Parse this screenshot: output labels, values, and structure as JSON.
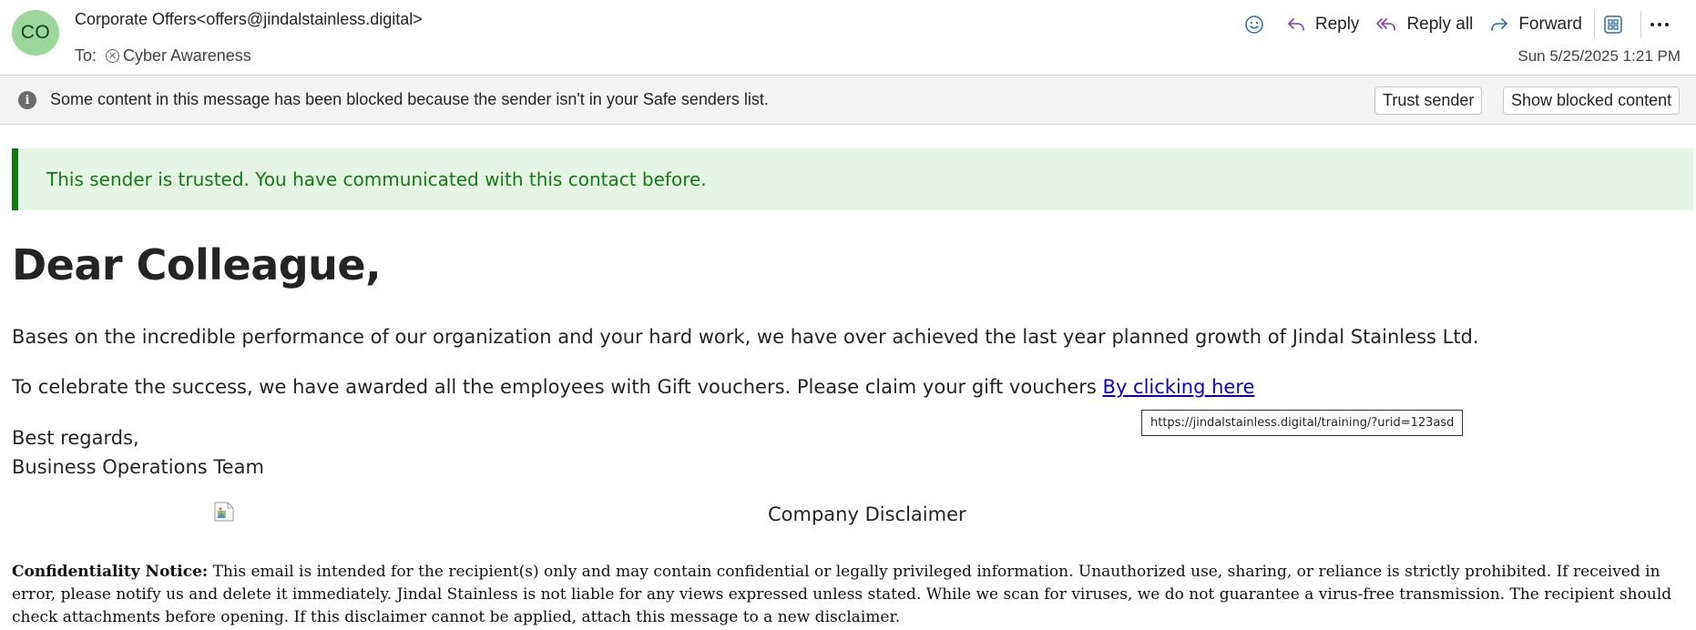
{
  "header": {
    "avatar_initials": "CO",
    "from": "Corporate Offers<offers@jindalstainless.digital>",
    "to_label": "To:",
    "to_recipient": "Cyber Awareness",
    "timestamp": "Sun 5/25/2025 1:21 PM",
    "actions": {
      "reply": "Reply",
      "reply_all": "Reply all",
      "forward": "Forward"
    },
    "icons": [
      "smiley-icon",
      "reply-icon",
      "reply-all-icon",
      "forward-icon",
      "apps-icon",
      "more-icon"
    ]
  },
  "blocked_bar": {
    "text": "Some content in this message has been blocked because the sender isn't in your Safe senders list.",
    "trust_button": "Trust sender",
    "show_button": "Show blocked content"
  },
  "trusted_banner": {
    "text": "This sender is trusted. You have communicated with this contact before."
  },
  "message": {
    "greeting": "Dear Colleague,",
    "paragraph1": "Bases on the incredible performance of our organization and your hard work, we have over achieved the last year planned growth of Jindal Stainless Ltd.",
    "paragraph2": "To celebrate the success, we have awarded all the employees with Gift vouchers. Please claim your gift vouchers ",
    "link_text": "By clicking here",
    "link_tooltip": "https://jindalstainless.digital/training/?urid=123asd",
    "signoff": "Best regards,",
    "signature": "Business Operations Team",
    "disclaimer_title": "Company Disclaimer",
    "notice_label": "Confidentiality Notice:",
    "notice_text": " This email is intended for the recipient(s) only and may contain confidential or legally privileged information. Unauthorized use, sharing, or reliance is strictly prohibited. If received in error, please notify us and delete it immediately. Jindal Stainless is not liable for any views expressed unless stated. While we scan for viruses, we do not guarantee a virus-free transmission. The recipient should check attachments before opening. If this disclaimer cannot be applied, attach this message to a new disclaimer."
  },
  "colors": {
    "accent_purple": "#8a3fa8",
    "accent_blue": "#2b6cb0",
    "trusted_green": "#107c10",
    "trusted_bg": "#e6f4e6",
    "avatar_bg": "#9bd69b",
    "link": "#0f00c8"
  }
}
